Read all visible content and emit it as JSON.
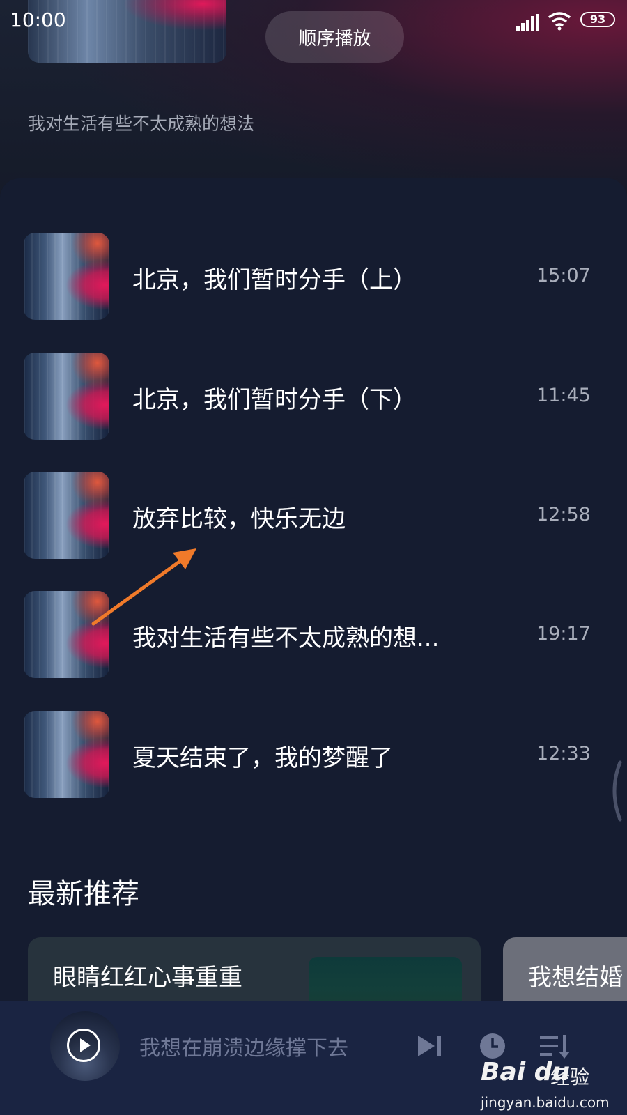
{
  "status_bar": {
    "time": "10:00",
    "battery": "93",
    "icons": [
      "signal-icon",
      "wifi-icon",
      "battery-icon"
    ]
  },
  "header": {
    "order_button_label": "顺序播放",
    "description": "我对生活有些不太成熟的想法"
  },
  "tracks": [
    {
      "title": "北京，我们暂时分手（上）",
      "duration": "15:07"
    },
    {
      "title": "北京，我们暂时分手（下）",
      "duration": "11:45"
    },
    {
      "title": "放弃比较，快乐无边",
      "duration": "12:58"
    },
    {
      "title": "我对生活有些不太成熟的想...",
      "duration": "19:17"
    },
    {
      "title": "夏天结束了，我的梦醒了",
      "duration": "12:33"
    }
  ],
  "recommend": {
    "section_title": "最新推荐",
    "cards": [
      {
        "title": "眼睛红红心事重重"
      },
      {
        "title": "我想结婚"
      }
    ]
  },
  "player": {
    "now_playing": "我想在崩溃边缘撑下去",
    "icons": [
      "play-icon",
      "next-icon",
      "timer-icon",
      "playlist-icon"
    ]
  },
  "watermark": {
    "brand": "Bai du",
    "product": "经验",
    "url": "jingyan.baidu.com"
  },
  "colors": {
    "background": "#141b2e",
    "annotation_arrow": "#f07a2a",
    "accent_pink": "#e2195b"
  }
}
